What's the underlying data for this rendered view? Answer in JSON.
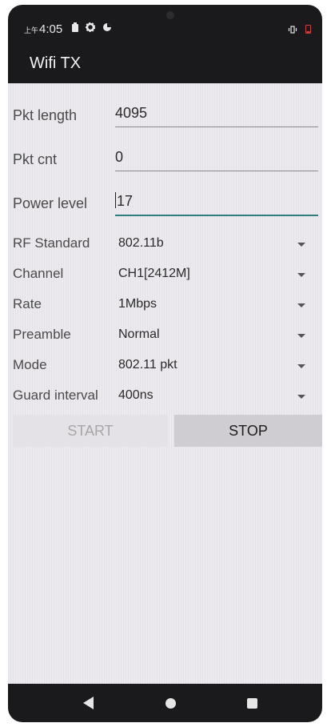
{
  "status_bar": {
    "time_prefix": "上午",
    "time": "4:05"
  },
  "app_bar": {
    "title": "Wifi TX"
  },
  "fields": [
    {
      "label": "Pkt length",
      "value": "4095"
    },
    {
      "label": "Pkt cnt",
      "value": "0"
    },
    {
      "label": "Power level",
      "value": "17"
    }
  ],
  "spinners": [
    {
      "label": "RF Standard",
      "value": "802.11b"
    },
    {
      "label": "Channel",
      "value": "CH1[2412M]"
    },
    {
      "label": "Rate",
      "value": "1Mbps"
    },
    {
      "label": "Preamble",
      "value": "Normal"
    },
    {
      "label": "Mode",
      "value": "802.11 pkt"
    },
    {
      "label": "Guard interval",
      "value": "400ns"
    }
  ],
  "buttons": {
    "start": "START",
    "stop": "STOP"
  },
  "icons": {
    "status": [
      "battery-icon",
      "gear-icon",
      "sync-icon",
      "vibrate-icon",
      "low-battery-icon"
    ],
    "nav": [
      "back-icon",
      "home-icon",
      "recent-apps-icon"
    ]
  },
  "colors": {
    "accent": "#2f7f7f",
    "app_bar": "#1a1a1c",
    "background": "#eceaee"
  }
}
